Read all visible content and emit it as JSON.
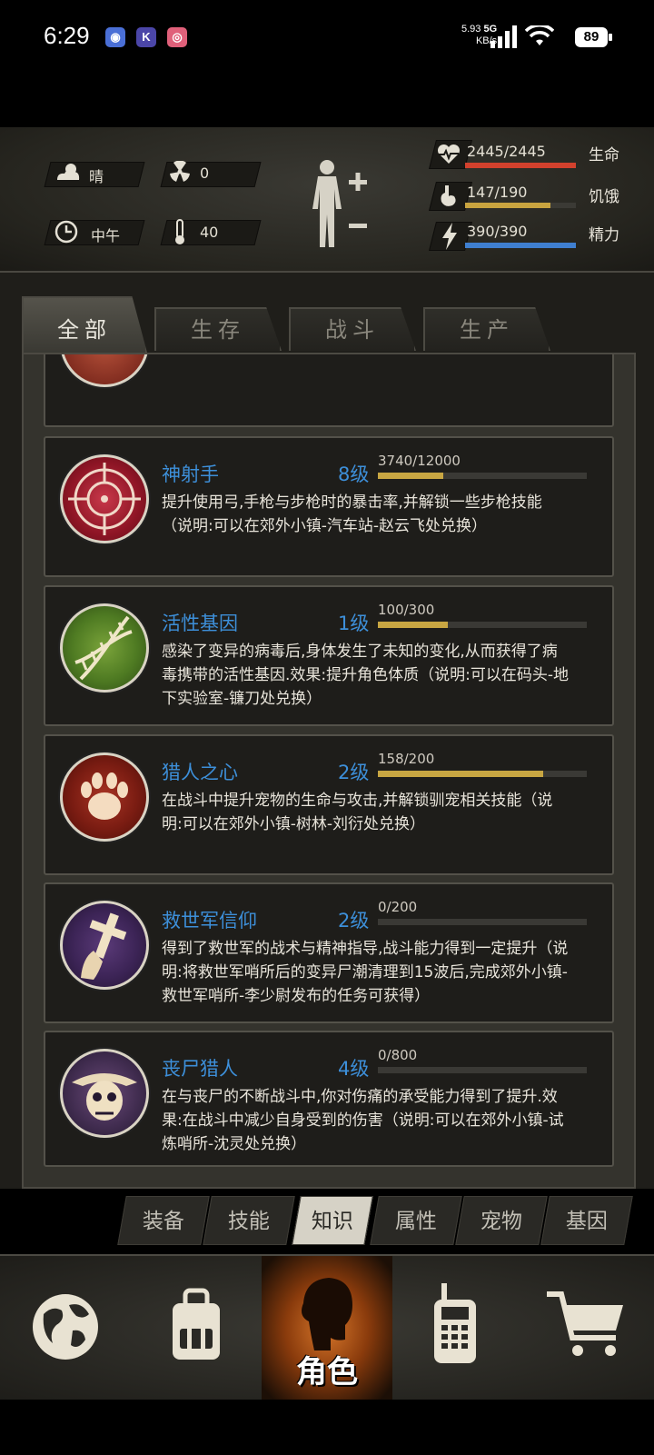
{
  "status_bar": {
    "time": "6:29",
    "speed_value": "5.93",
    "speed_unit": "KB/s",
    "network": "5G",
    "battery": "89"
  },
  "stats": {
    "weather": "晴",
    "radiation": "0",
    "time_of_day": "中午",
    "temperature": "40",
    "health": {
      "label": "生命",
      "value": "2445/2445",
      "fraction": 1.0,
      "color": "#d2412d"
    },
    "hunger": {
      "label": "饥饿",
      "value": "147/190",
      "fraction": 0.774,
      "color": "#c9a43f"
    },
    "energy": {
      "label": "精力",
      "value": "390/390",
      "fraction": 1.0,
      "color": "#3f7fd0"
    }
  },
  "tabs": [
    "全部",
    "生存",
    "战斗",
    "生产"
  ],
  "skills": [
    {
      "name": "神射手",
      "level": "8级",
      "exp": "3740/12000",
      "fraction": 0.312,
      "icon": "crosshair-icon",
      "description": "提升使用弓,手枪与步枪时的暴击率,并解锁一些步枪技能（说明:可以在郊外小镇-汽车站-赵云飞处兑换）"
    },
    {
      "name": "活性基因",
      "level": "1级",
      "exp": "100/300",
      "fraction": 0.333,
      "icon": "dna-icon",
      "description": "感染了变异的病毒后,身体发生了未知的变化,从而获得了病毒携带的活性基因.效果:提升角色体质（说明:可以在码头-地下实验室-镰刀处兑换）"
    },
    {
      "name": "猎人之心",
      "level": "2级",
      "exp": "158/200",
      "fraction": 0.79,
      "icon": "paw-icon",
      "description": "在战斗中提升宠物的生命与攻击,并解锁驯宠相关技能（说明:可以在郊外小镇-树林-刘衍处兑换）"
    },
    {
      "name": "救世军信仰",
      "level": "2级",
      "exp": "0/200",
      "fraction": 0,
      "icon": "praying-cross-icon",
      "description": "得到了救世军的战术与精神指导,战斗能力得到一定提升（说明:将救世军哨所后的变异尸潮清理到15波后,完成郊外小镇-救世军哨所-李少尉发布的任务可获得）"
    },
    {
      "name": "丧尸猎人",
      "level": "4级",
      "exp": "0/800",
      "fraction": 0,
      "icon": "skull-hunter-icon",
      "description": "在与丧尸的不断战斗中,你对伤痛的承受能力得到了提升.效果:在战斗中减少自身受到的伤害（说明:可以在郊外小镇-试炼哨所-沈灵处兑换）"
    }
  ],
  "subtabs": [
    "装备",
    "技能",
    "知识",
    "属性",
    "宠物",
    "基因"
  ],
  "active_subtab": "知识",
  "bottom_nav": {
    "items": [
      "globe-icon",
      "backpack-icon",
      "character-icon",
      "radio-icon",
      "cart-icon"
    ],
    "active_label": "角色"
  }
}
